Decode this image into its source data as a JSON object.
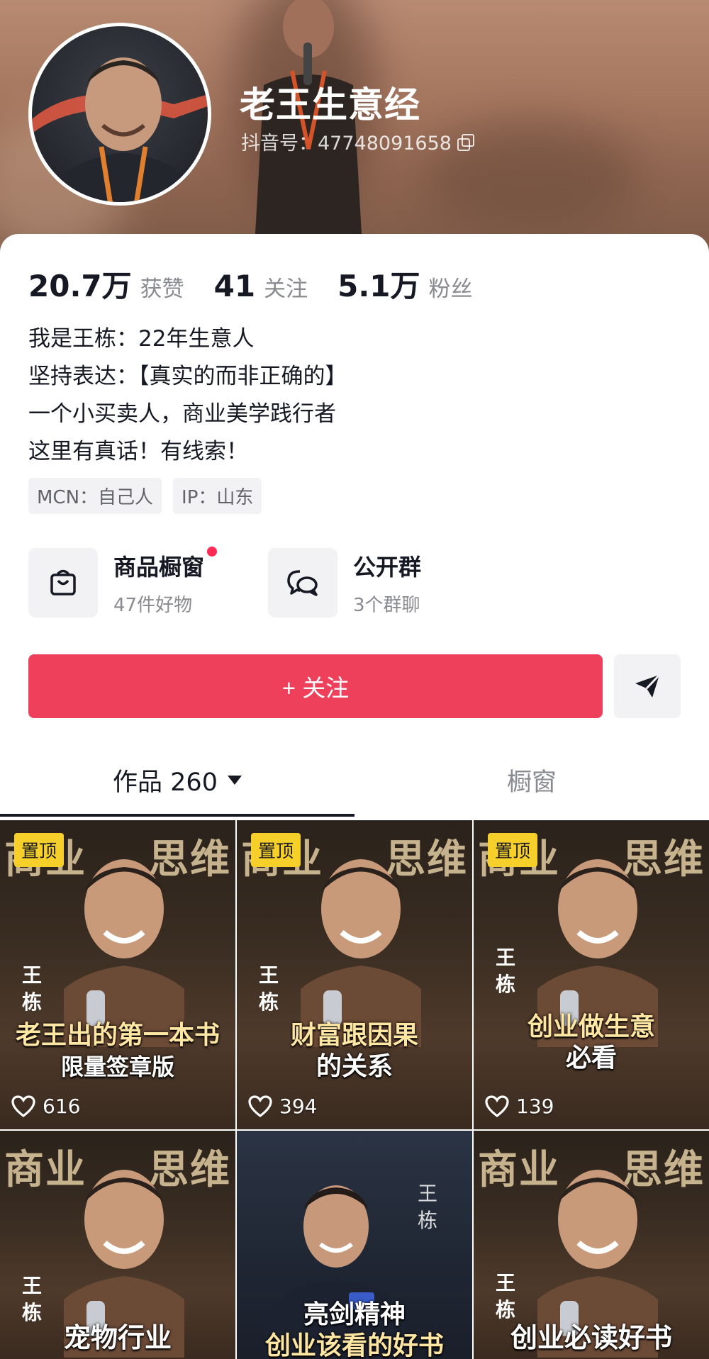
{
  "profile": {
    "name": "老王生意经",
    "douyin_id": "抖音号：47748091658",
    "stats": [
      {
        "num": "20.7万",
        "label": "获赞"
      },
      {
        "num": "41",
        "label": "关注"
      },
      {
        "num": "5.1万",
        "label": "粉丝"
      }
    ],
    "bio": [
      "我是王栋：22年生意人",
      "坚持表达：【真实的而非正确的】",
      "一个小买卖人，商业美学践行者",
      "这里有真话！有线索！"
    ],
    "tags": [
      "MCN：自己人",
      "IP：山东"
    ]
  },
  "entries": {
    "shop": {
      "title": "商品橱窗",
      "sub": "47件好物",
      "icon": "shopping-bag-icon"
    },
    "group": {
      "title": "公开群",
      "sub": "3个群聊",
      "icon": "chat-bubbles-icon"
    }
  },
  "actions": {
    "follow_label": "+ 关注",
    "share_icon": "send-icon"
  },
  "tabs": {
    "works": "作品 260",
    "shop": "橱窗"
  },
  "videos": [
    {
      "bg_left": "商业",
      "bg_right": "思维",
      "vname": [
        "王",
        "栋"
      ],
      "caption1": "老王出的第一本书",
      "caption2": "限量签章版",
      "likes": "616",
      "pinned": "置顶"
    },
    {
      "bg_left": "商业",
      "bg_right": "思维",
      "vname": [
        "王",
        "栋"
      ],
      "caption1": "财富跟因果",
      "caption2": "的关系",
      "likes": "394",
      "pinned": "置顶"
    },
    {
      "bg_left": "商业",
      "bg_right": "思维",
      "vname": [
        "王",
        "栋"
      ],
      "caption1": "创业做生意",
      "caption2": "必看",
      "likes": "139",
      "pinned": "置顶"
    },
    {
      "bg_left": "商业",
      "bg_right": "思维",
      "vname": [
        "王",
        "栋"
      ],
      "caption1": "宠物行业",
      "caption2": ""
    },
    {
      "vname": [
        "王",
        "栋"
      ],
      "caption1": "亮剑精神",
      "caption2": "创业该看的好书"
    },
    {
      "bg_left": "商业",
      "bg_right": "思维",
      "vname": [
        "王",
        "栋"
      ],
      "caption1": "创业必读好书",
      "caption2": ""
    }
  ],
  "colors": {
    "follow_button": "#ee3f5b",
    "pin_badge": "#f7cf2a",
    "red_dot": "#fe2c55"
  }
}
